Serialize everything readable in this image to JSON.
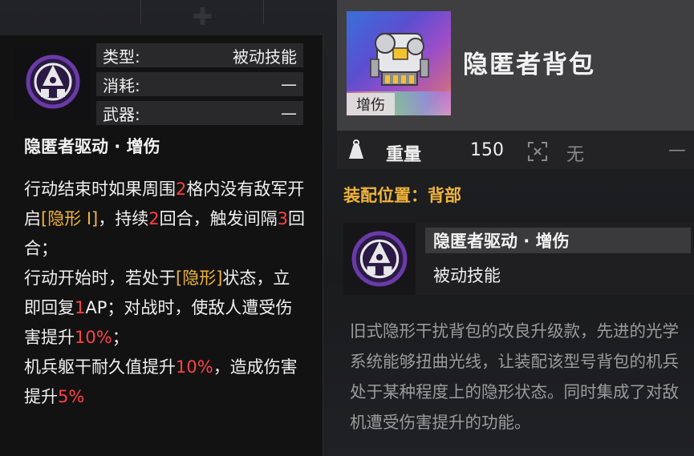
{
  "skill_panel": {
    "icon": "hidden-drive-emblem-icon",
    "rows": [
      {
        "label": "类型:",
        "value": "被动技能"
      },
      {
        "label": "消耗:",
        "value": "—"
      },
      {
        "label": "武器:",
        "value": "—"
      }
    ],
    "name": "隐匿者驱动 · 增伤",
    "desc": {
      "p1": "行动结束时如果周围",
      "n1": "2",
      "p2": "格内没有敌军开启",
      "tag1": "[隐形 Ⅰ]",
      "p3": "，持续",
      "n2": "2",
      "p4": "回合，触发间隔",
      "n3": "3",
      "p5": "回合；",
      "p6": "行动开始时，若处于",
      "tag2": "[隐形]",
      "p7": "状态，立即回复",
      "n4": "1",
      "p8": "AP；对战时，使敌人遭受伤害提升",
      "n5": "10%",
      "p9": "；",
      "p10": "机兵躯干耐久值提升",
      "n6": "10%",
      "p11": "，造成伤害提升",
      "n7": "5%"
    }
  },
  "item_panel": {
    "title": "隐匿者背包",
    "thumb_tag": "增伤",
    "thumb_icon": "backpack-mech-icon",
    "weight_icon": "weight-icon",
    "weight_label": "重量",
    "weight_value": "150",
    "range_icon": "crosshair-range-icon",
    "range_value": "无",
    "range_dash": "—",
    "slot_line": "装配位置：背部",
    "bound_skill_name": "隐匿者驱动 · 增伤",
    "bound_skill_type": "被动技能",
    "flavor": "旧式隐形干扰背包的改良升级款，先进的光学系统能够扭曲光线，让装配该型号背包的机兵处于某种程度上的隐形状态。同时集成了对敌机遭受伤害提升的功能。"
  },
  "colors": {
    "highlight_red": "#ff4141",
    "highlight_gold": "#f0b43a",
    "emblem_purple": "#6a3aa8"
  }
}
